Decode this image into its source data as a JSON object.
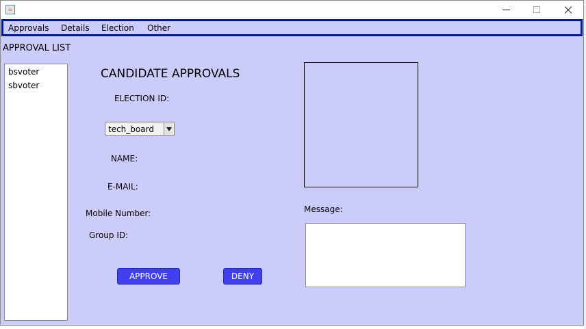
{
  "window": {
    "title": ""
  },
  "menu": [
    "Approvals",
    "Details",
    "Election",
    "Other"
  ],
  "approval_list": {
    "title": "APPROVAL LIST",
    "items": [
      "bsvoter",
      "sbvoter"
    ]
  },
  "form": {
    "heading": "CANDIDATE APPROVALS",
    "election_id_label": "ELECTION  ID:",
    "election_select_value": "tech_board",
    "name_label": "NAME:",
    "email_label": "E-MAIL:",
    "mobile_label": "Mobile Number:",
    "group_label": "Group ID:",
    "message_label": "Message:"
  },
  "buttons": {
    "approve": "APPROVE",
    "deny": "DENY"
  },
  "colors": {
    "window_bg": "#ccccfa",
    "button_bg": "#4040ee",
    "menubar_border": "#001a8a"
  }
}
